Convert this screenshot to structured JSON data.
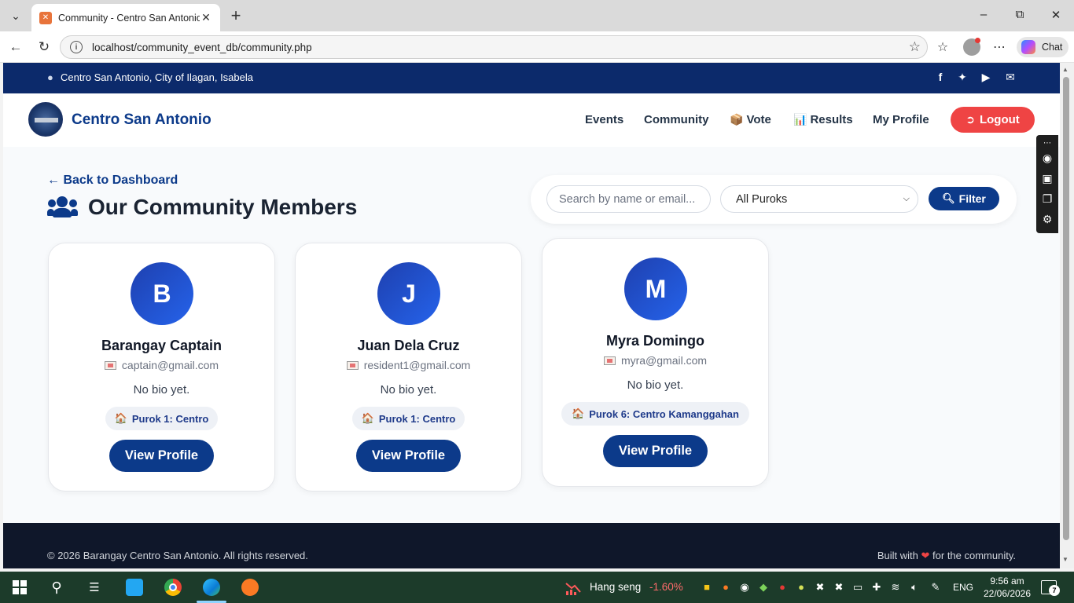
{
  "browser": {
    "tab_title": "Community - Centro San Antonio",
    "url": "localhost/community_event_db/community.php",
    "chat_label": "Chat"
  },
  "topbar": {
    "location": "Centro San Antonio, City of Ilagan, Isabela",
    "social_icons": [
      "facebook-icon",
      "twitter-icon",
      "youtube-icon",
      "envelope-icon"
    ]
  },
  "header": {
    "brand": "Centro San Antonio",
    "nav": {
      "events": "Events",
      "community": "Community",
      "vote": "Vote",
      "results": "Results",
      "my_profile": "My Profile"
    },
    "logout": "Logout"
  },
  "main": {
    "back_link": "Back to Dashboard",
    "title": "Our Community Members",
    "search_placeholder": "Search by name or email...",
    "purok_select": "All Puroks",
    "filter_button": "Filter",
    "members": [
      {
        "initial": "B",
        "name": "Barangay Captain",
        "email": "captain@gmail.com",
        "bio": "No bio yet.",
        "purok": "Purok 1: Centro",
        "button": "View Profile"
      },
      {
        "initial": "J",
        "name": "Juan Dela Cruz",
        "email": "resident1@gmail.com",
        "bio": "No bio yet.",
        "purok": "Purok 1: Centro",
        "button": "View Profile"
      },
      {
        "initial": "M",
        "name": "Myra Domingo",
        "email": "myra@gmail.com",
        "bio": "No bio yet.",
        "purok": "Purok 6: Centro Kamanggahan",
        "button": "View Profile"
      }
    ]
  },
  "footer": {
    "copyright": "© 2026 Barangay Centro San Antonio. All rights reserved.",
    "built_prefix": "Built with",
    "built_suffix": "for the community."
  },
  "taskbar": {
    "ticker_name": "Hang seng",
    "ticker_value": "-1.60%",
    "language": "ENG",
    "time": "9:56 am",
    "date": "22/06/2026",
    "notification_count": "7"
  },
  "colors": {
    "primary": "#0c3a8a",
    "topbar": "#0c2a6b",
    "logout": "#ef4444",
    "footer": "#0f172a"
  }
}
